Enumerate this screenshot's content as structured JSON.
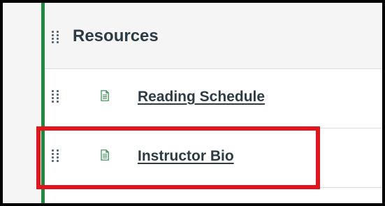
{
  "module": {
    "title": "Resources",
    "accent_color": "#1e8a3e",
    "items": [
      {
        "label": "Reading Schedule",
        "icon": "page-icon",
        "highlighted": false
      },
      {
        "label": "Instructor Bio",
        "icon": "page-icon",
        "highlighted": true
      }
    ]
  },
  "colors": {
    "text": "#2d3b45",
    "header_bg": "#f5f5f5",
    "highlight_border": "#e3141b",
    "frame_border": "#000000"
  },
  "icons": {
    "drag_handle": "drag-handle-icon",
    "page": "page-icon"
  }
}
